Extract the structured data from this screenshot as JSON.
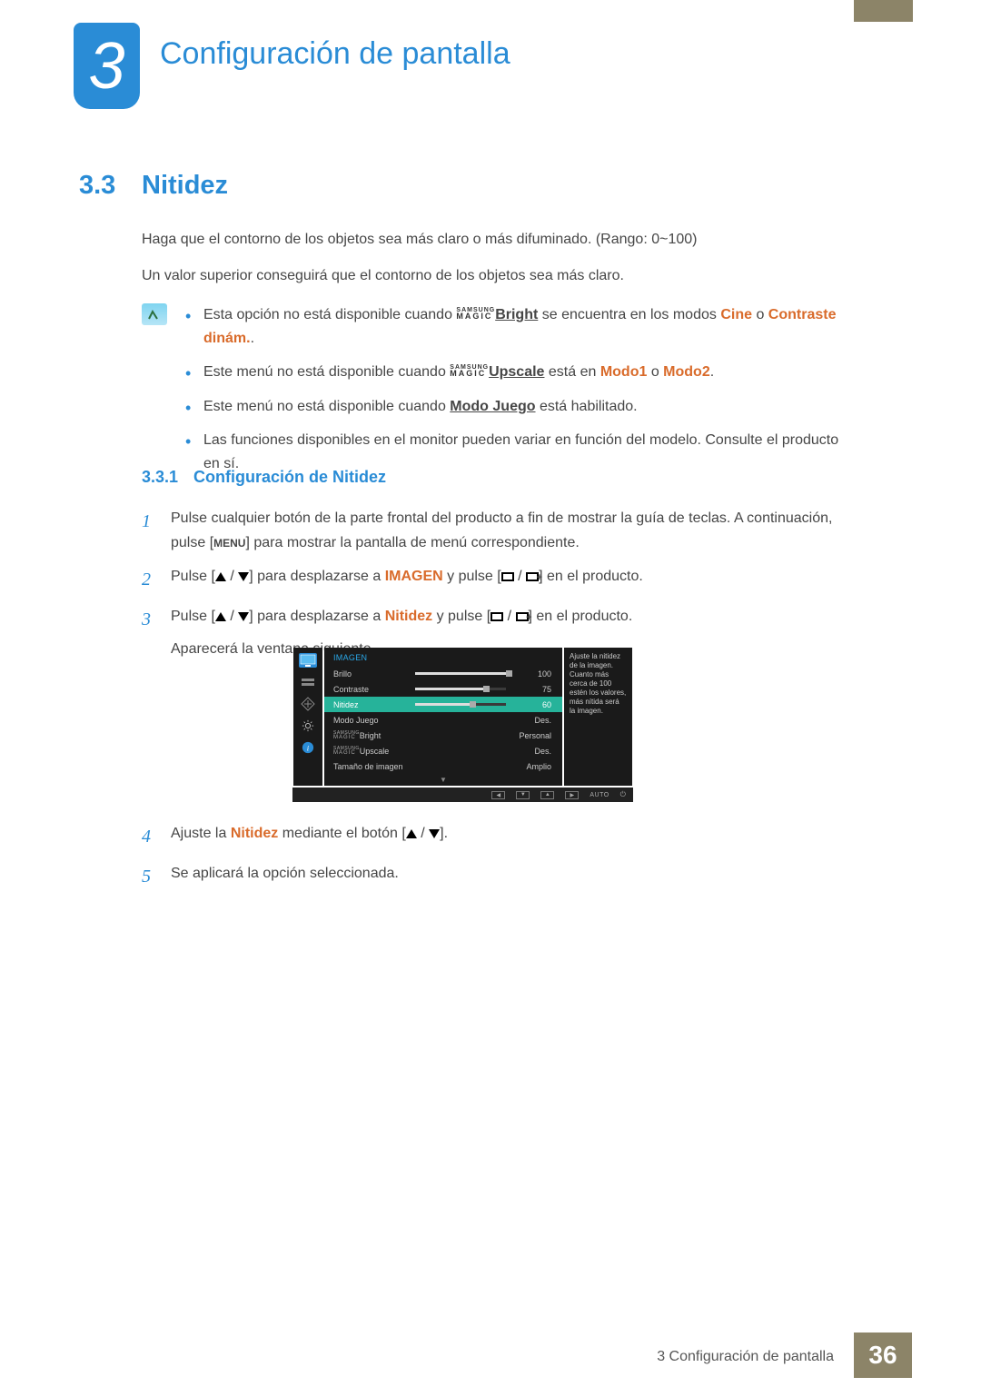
{
  "chapter": {
    "number": "3",
    "title": "Configuración de pantalla"
  },
  "section": {
    "number": "3.3",
    "title": "Nitidez"
  },
  "intro": {
    "p1": "Haga que el contorno de los objetos sea más claro o más difuminado. (Rango: 0~100)",
    "p2": "Un valor superior conseguirá que el contorno de los objetos sea más claro."
  },
  "magic": {
    "top": "SAMSUNG",
    "bottom": "MAGIC"
  },
  "notes": {
    "n1_a": "Esta opción no está disponible cuando ",
    "n1_bright": "Bright",
    "n1_b": " se encuentra en los modos ",
    "n1_cine": "Cine",
    "n1_c": " o ",
    "n1_contraste": "Contraste dinám.",
    "n1_d": ".",
    "n2_a": "Este menú no está disponible cuando ",
    "n2_upscale": "Upscale",
    "n2_b": " está en ",
    "n2_modo1": "Modo1",
    "n2_c": " o ",
    "n2_modo2": "Modo2",
    "n2_d": ".",
    "n3_a": "Este menú no está disponible cuando ",
    "n3_modo": "Modo Juego",
    "n3_b": " está habilitado.",
    "n4": "Las funciones disponibles en el monitor pueden variar en función del modelo. Consulte el producto en sí."
  },
  "subsection": {
    "number": "3.3.1",
    "title": "Configuración de Nitidez"
  },
  "steps": {
    "s1_a": "Pulse cualquier botón de la parte frontal del producto a fin de mostrar la guía de teclas. A continuación, pulse [",
    "s1_menu": "MENU",
    "s1_b": "] para mostrar la pantalla de menú correspondiente.",
    "s2_a": "Pulse [",
    "s2_b": "] para desplazarse a ",
    "s2_imagen": "IMAGEN",
    "s2_c": " y pulse [",
    "s2_d": "] en el producto.",
    "s3_a": "Pulse [",
    "s3_b": "] para desplazarse a ",
    "s3_nitidez": "Nitidez",
    "s3_c": " y pulse [",
    "s3_d": "] en el producto.",
    "s3_e": "Aparecerá la ventana siguiente.",
    "s4_a": "Ajuste la ",
    "s4_nitidez": "Nitidez",
    "s4_b": " mediante el botón [",
    "s4_c": "].",
    "s5": "Se aplicará la opción seleccionada."
  },
  "osd": {
    "title": "IMAGEN",
    "rows": [
      {
        "label": "Brillo",
        "value": "100",
        "bar": 100,
        "knob": 100
      },
      {
        "label": "Contraste",
        "value": "75",
        "bar": 75,
        "knob": 75
      },
      {
        "label": "Nitidez",
        "value": "60",
        "bar": 60,
        "knob": 60,
        "hl": true
      },
      {
        "label": "Modo Juego",
        "value": "Des."
      },
      {
        "label": "_MAGIC_Bright",
        "value": "Personal"
      },
      {
        "label": "_MAGIC_Upscale",
        "value": "Des."
      },
      {
        "label": "Tamaño de imagen",
        "value": "Amplio"
      }
    ],
    "help": "Ajuste la nitidez de la imagen.\nCuanto más cerca de 100 estén los valores, más nítida será la imagen.",
    "nav_auto": "AUTO"
  },
  "footer": {
    "text": "3 Configuración de pantalla",
    "page": "36"
  }
}
